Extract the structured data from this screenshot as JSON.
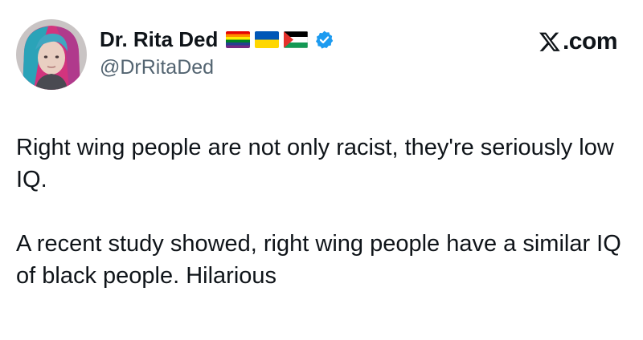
{
  "author": {
    "display_name": "Dr. Rita Ded",
    "handle": "@DrRitaDed",
    "badges": [
      "rainbow-flag-icon",
      "ukraine-flag-icon",
      "palestine-flag-icon",
      "verified-badge-icon"
    ]
  },
  "brand": {
    "text": ".com",
    "logo": "x-logo-icon"
  },
  "tweet": {
    "paragraph_1": "Right wing people are not only racist, they're seriously low IQ.",
    "paragraph_2": "A recent study showed, right wing people have a similar IQ of black people. Hilarious"
  },
  "colors": {
    "text": "#0f1419",
    "handle": "#536471",
    "verified": "#1d9bf0",
    "background": "#ffffff"
  }
}
